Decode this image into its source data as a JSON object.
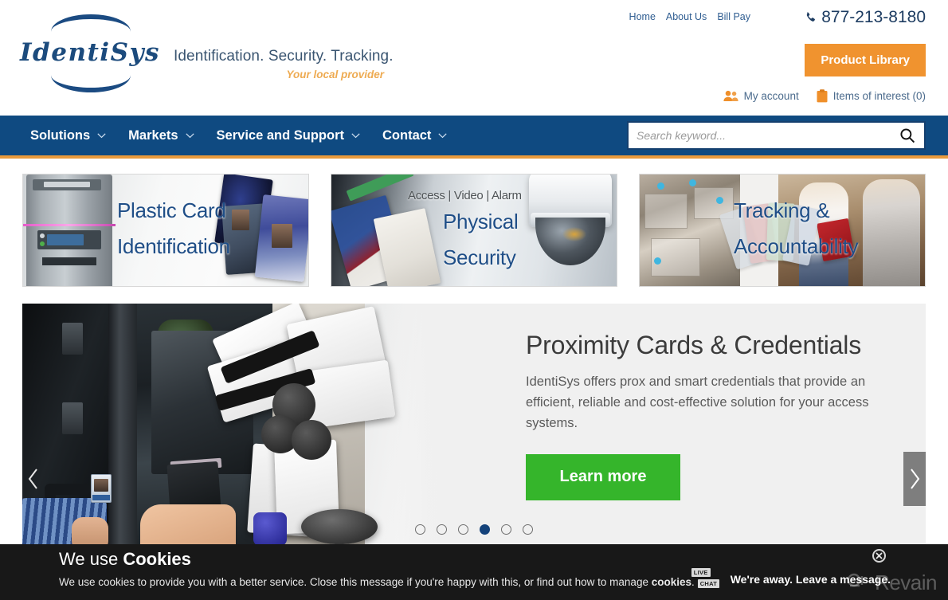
{
  "header": {
    "logo": {
      "word": "IdentiSys",
      "icon": "logo-arcs"
    },
    "tagline": "Identification. Security. Tracking.",
    "tagline_sub": "Your local provider",
    "top_links": [
      {
        "label": "Home",
        "name": "home"
      },
      {
        "label": "About Us",
        "name": "about-us"
      },
      {
        "label": "Bill Pay",
        "name": "bill-pay"
      }
    ],
    "phone": "877-213-8180",
    "phone_icon": "phone-icon",
    "product_library_label": "Product Library",
    "account": {
      "my_account_label": "My account",
      "my_account_icon": "users-icon",
      "items_label": "Items of interest (0)",
      "items_icon": "clipboard-icon",
      "items_count": 0
    }
  },
  "nav": {
    "items": [
      {
        "label": "Solutions"
      },
      {
        "label": "Markets"
      },
      {
        "label": "Service and Support"
      },
      {
        "label": "Contact"
      }
    ],
    "chevron_icon": "chevron-down-icon"
  },
  "search": {
    "placeholder": "Search keyword...",
    "value": "",
    "icon": "search-icon"
  },
  "tiles": [
    {
      "name": "plastic-card-identification",
      "line1": "Plastic Card",
      "line2": "Identification",
      "eyebrow": ""
    },
    {
      "name": "physical-security",
      "eyebrow": "Access | Video | Alarm",
      "line1": "Physical",
      "line2": "Security"
    },
    {
      "name": "tracking-accountability",
      "line1": "Tracking &",
      "line2": "Accountability",
      "eyebrow": ""
    }
  ],
  "hero": {
    "title": "Proximity Cards & Credentials",
    "description": "IdentiSys offers prox and smart credentials that provide an efficient, reliable and cost-effective solution for your access systems.",
    "cta_label": "Learn more",
    "prev_icon": "chevron-left-icon",
    "next_icon": "chevron-right-icon",
    "dots_total": 6,
    "dots_active_index": 3
  },
  "cookie_banner": {
    "title_prefix": "We use ",
    "title_strong": "Cookies",
    "text_prefix": "We use cookies to provide you with a better service. Close this message if you're happy with this, or find out how to manage ",
    "text_strong": "cookies",
    "text_suffix": ".",
    "close_icon": "close-icon"
  },
  "live_chat": {
    "badge_line1": "LIVE",
    "badge_line2": "CHAT",
    "message": "We're away.  Leave a message."
  },
  "watermark": {
    "text": "Revain"
  },
  "colors": {
    "nav_blue": "#0f4a81",
    "accent_orange": "#f0932f",
    "nav_border_orange": "#e89a3c",
    "cta_green": "#35b52b",
    "tile_text_blue": "#1f4e87",
    "tagline_orange": "#eeab52",
    "cookie_bg": "#181818"
  }
}
